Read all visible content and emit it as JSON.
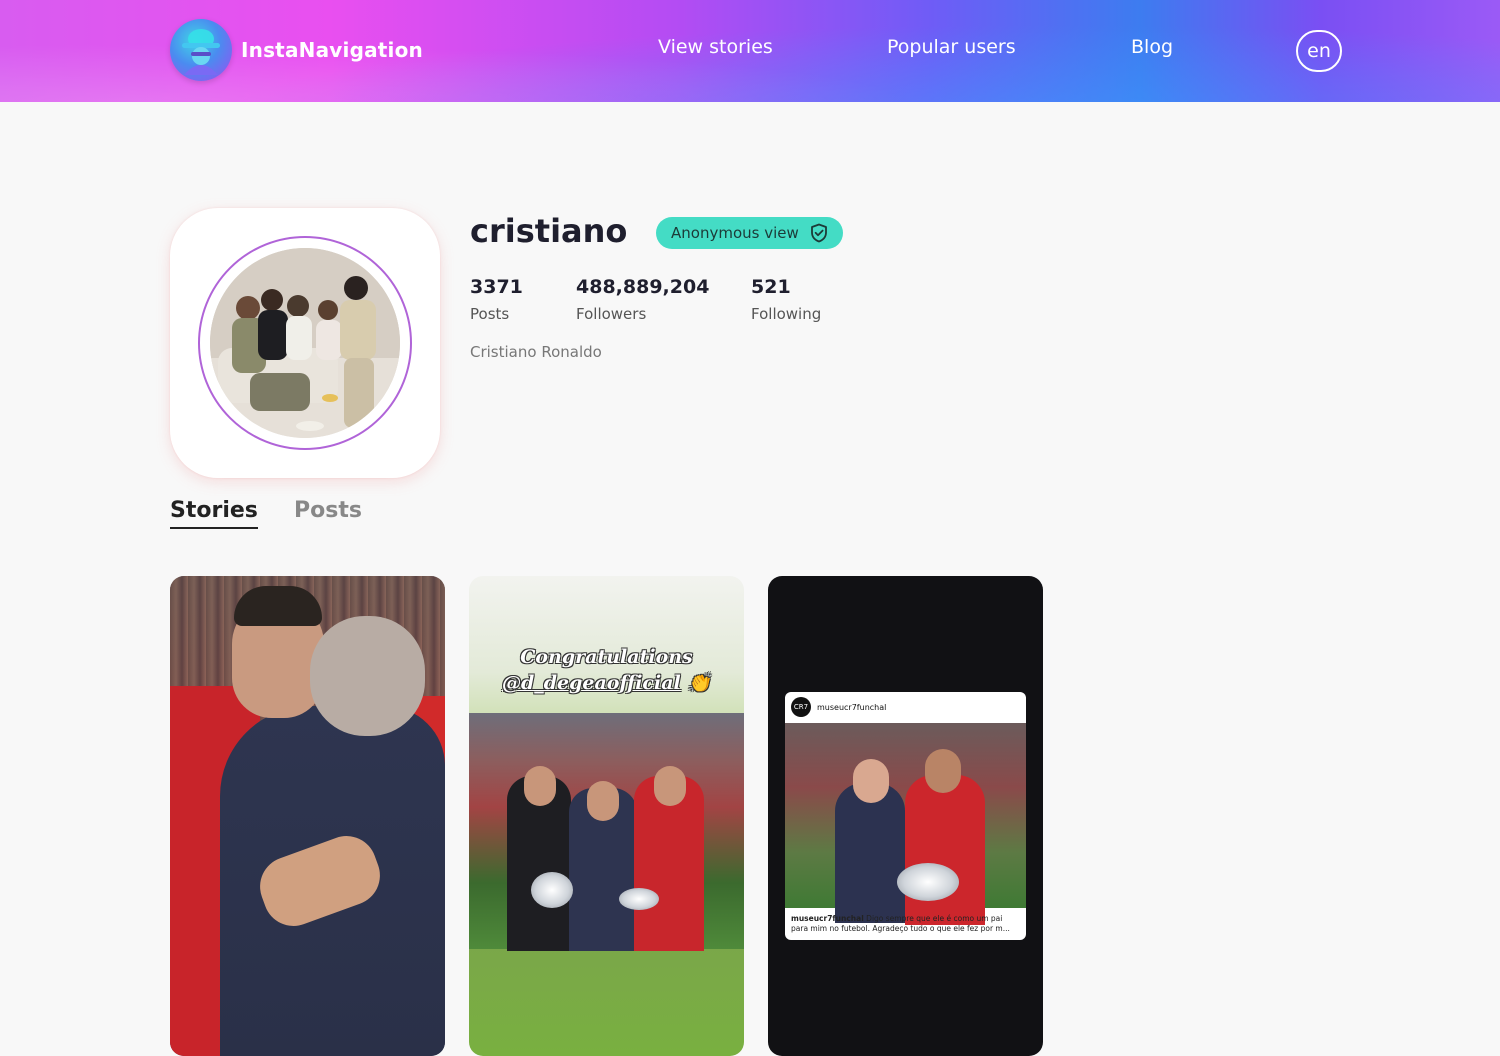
{
  "header": {
    "brand": "InstaNavigation",
    "nav": {
      "view_stories": "View stories",
      "popular_users": "Popular users",
      "blog": "Blog"
    },
    "language": "en"
  },
  "profile": {
    "username": "cristiano",
    "badge": "Anonymous view",
    "stats": {
      "posts_value": "3371",
      "posts_label": "Posts",
      "followers_value": "488,889,204",
      "followers_label": "Followers",
      "following_value": "521",
      "following_label": "Following"
    },
    "full_name": "Cristiano Ronaldo"
  },
  "tabs": {
    "stories": "Stories",
    "posts": "Posts",
    "active": "stories"
  },
  "stories": {
    "story2": {
      "line1": "Congratulations",
      "line2": "@d_degeaofficial",
      "emoji": "👏"
    },
    "story3": {
      "avatar_text": "CR7",
      "account": "museucr7funchal",
      "caption_user": "museucr7funchal",
      "caption_text": "Digo sempre que ele é como um pai",
      "caption_line2": "para mim no futebol. Agradeço tudo o que ele fez por m..."
    }
  },
  "colors": {
    "badge": "#44dcc5",
    "avatar_ring": "#b064d8",
    "background": "#f8f8f8"
  }
}
